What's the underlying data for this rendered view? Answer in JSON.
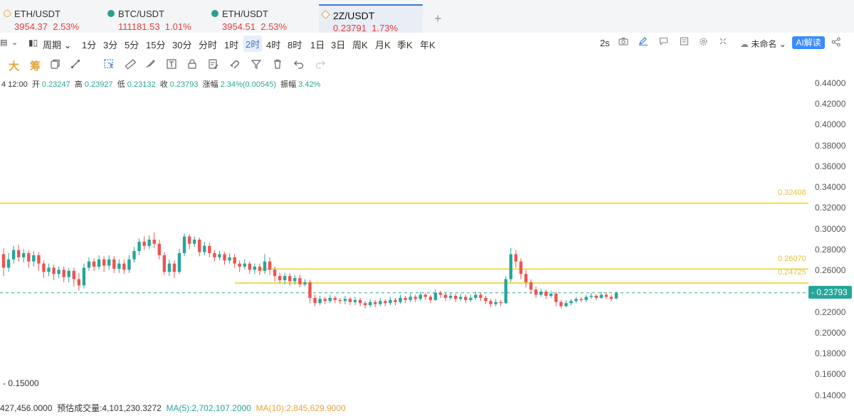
{
  "tabs": [
    {
      "symbol": "ETH/USDT",
      "price": "3954.37",
      "change": "2.53%"
    },
    {
      "symbol": "BTC/USDT",
      "price": "111181.53",
      "change": "1.01%"
    },
    {
      "symbol": "ETH/USDT",
      "price": "3954.51",
      "change": "2.53%"
    },
    {
      "symbol": "2Z/USDT",
      "price": "0.23791",
      "change": "1.73%"
    }
  ],
  "toolbar": {
    "period_label": "周期",
    "intervals": [
      "1分",
      "3分",
      "5分",
      "15分",
      "30分",
      "分时",
      "1时",
      "2时",
      "4时",
      "8时",
      "1日",
      "3日",
      "周K",
      "月K",
      "季K",
      "年K"
    ],
    "selected_interval": "2时",
    "refresh_rate": "2s",
    "layout_name": "未命名",
    "ai_button": "AI解读",
    "da_label": "大",
    "chou_label": "筹"
  },
  "ohlc": {
    "time": "4 12:00",
    "open_label": "开",
    "open": "0.23247",
    "high_label": "高",
    "high": "0.23927",
    "low_label": "低",
    "low": "0.23132",
    "close_label": "收",
    "close": "0.23793",
    "change_label": "涨幅",
    "change": "2.34%(0.00545)",
    "amp_label": "振幅",
    "amp": "3.42%"
  },
  "price_axis": [
    "0.44000",
    "0.42000",
    "0.40000",
    "0.38000",
    "0.36000",
    "0.34000",
    "0.32000",
    "0.30000",
    "0.28000",
    "0.26000",
    "0.22000",
    "0.20000",
    "0.18000",
    "0.16000",
    "0.14000"
  ],
  "horizontal_lines": [
    {
      "label": "0.32408",
      "price": 0.32408
    },
    {
      "label": "0.26070",
      "price": 0.2607
    },
    {
      "label": "0.24725",
      "price": 0.24725
    }
  ],
  "current_price": "0.23793",
  "left_value": "- 0.15000",
  "volume": {
    "prev": "427,456.0000",
    "est_label": "预估成交量:4,101,230.3272",
    "ma5": "MA(5):2,702,107.2000",
    "ma10": "MA(10):2,845,629.9000"
  },
  "colors": {
    "up": "#26a69a",
    "down": "#ef5350",
    "line": "#f2d31a",
    "accent": "#3a78d8"
  },
  "candles": [
    [
      0.275,
      0.262,
      0.281,
      0.254
    ],
    [
      0.262,
      0.27,
      0.276,
      0.258
    ],
    [
      0.27,
      0.279,
      0.283,
      0.266
    ],
    [
      0.279,
      0.272,
      0.284,
      0.268
    ],
    [
      0.272,
      0.276,
      0.28,
      0.267
    ],
    [
      0.276,
      0.268,
      0.279,
      0.262
    ],
    [
      0.268,
      0.274,
      0.278,
      0.263
    ],
    [
      0.274,
      0.266,
      0.277,
      0.259
    ],
    [
      0.266,
      0.258,
      0.269,
      0.252
    ],
    [
      0.258,
      0.262,
      0.266,
      0.254
    ],
    [
      0.262,
      0.256,
      0.265,
      0.25
    ],
    [
      0.256,
      0.26,
      0.263,
      0.252
    ],
    [
      0.26,
      0.253,
      0.263,
      0.248
    ],
    [
      0.253,
      0.259,
      0.262,
      0.248
    ],
    [
      0.259,
      0.251,
      0.262,
      0.244
    ],
    [
      0.251,
      0.245,
      0.257,
      0.24
    ],
    [
      0.245,
      0.262,
      0.266,
      0.242
    ],
    [
      0.262,
      0.268,
      0.272,
      0.259
    ],
    [
      0.268,
      0.263,
      0.271,
      0.259
    ],
    [
      0.263,
      0.27,
      0.274,
      0.26
    ],
    [
      0.27,
      0.264,
      0.273,
      0.258
    ],
    [
      0.264,
      0.27,
      0.274,
      0.26
    ],
    [
      0.27,
      0.261,
      0.273,
      0.257
    ],
    [
      0.261,
      0.266,
      0.27,
      0.257
    ],
    [
      0.266,
      0.26,
      0.27,
      0.256
    ],
    [
      0.26,
      0.27,
      0.274,
      0.257
    ],
    [
      0.27,
      0.278,
      0.282,
      0.267
    ],
    [
      0.278,
      0.287,
      0.29,
      0.274
    ],
    [
      0.287,
      0.283,
      0.292,
      0.279
    ],
    [
      0.283,
      0.289,
      0.293,
      0.28
    ],
    [
      0.289,
      0.285,
      0.296,
      0.281
    ],
    [
      0.285,
      0.274,
      0.289,
      0.27
    ],
    [
      0.274,
      0.258,
      0.277,
      0.255
    ],
    [
      0.258,
      0.266,
      0.27,
      0.254
    ],
    [
      0.266,
      0.258,
      0.269,
      0.252
    ],
    [
      0.258,
      0.276,
      0.28,
      0.256
    ],
    [
      0.276,
      0.292,
      0.295,
      0.273
    ],
    [
      0.292,
      0.285,
      0.294,
      0.28
    ],
    [
      0.285,
      0.289,
      0.292,
      0.282
    ],
    [
      0.289,
      0.277,
      0.291,
      0.273
    ],
    [
      0.277,
      0.283,
      0.287,
      0.274
    ],
    [
      0.283,
      0.276,
      0.286,
      0.272
    ],
    [
      0.276,
      0.272,
      0.279,
      0.268
    ],
    [
      0.272,
      0.275,
      0.278,
      0.269
    ],
    [
      0.275,
      0.269,
      0.277,
      0.265
    ],
    [
      0.269,
      0.272,
      0.276,
      0.266
    ],
    [
      0.272,
      0.266,
      0.275,
      0.262
    ],
    [
      0.266,
      0.263,
      0.269,
      0.258
    ],
    [
      0.263,
      0.266,
      0.27,
      0.26
    ],
    [
      0.266,
      0.26,
      0.268,
      0.256
    ],
    [
      0.26,
      0.263,
      0.266,
      0.256
    ],
    [
      0.263,
      0.259,
      0.266,
      0.255
    ],
    [
      0.259,
      0.268,
      0.275,
      0.256
    ],
    [
      0.268,
      0.26,
      0.272,
      0.255
    ],
    [
      0.26,
      0.254,
      0.263,
      0.249
    ],
    [
      0.254,
      0.25,
      0.257,
      0.247
    ],
    [
      0.25,
      0.254,
      0.257,
      0.246
    ],
    [
      0.254,
      0.249,
      0.257,
      0.245
    ],
    [
      0.249,
      0.252,
      0.255,
      0.246
    ],
    [
      0.252,
      0.246,
      0.255,
      0.243
    ],
    [
      0.246,
      0.248,
      0.251,
      0.244
    ],
    [
      0.248,
      0.233,
      0.25,
      0.228
    ],
    [
      0.233,
      0.228,
      0.236,
      0.225
    ],
    [
      0.228,
      0.232,
      0.235,
      0.226
    ],
    [
      0.232,
      0.23,
      0.234,
      0.227
    ],
    [
      0.23,
      0.233,
      0.236,
      0.228
    ],
    [
      0.233,
      0.231,
      0.235,
      0.228
    ],
    [
      0.231,
      0.23,
      0.233,
      0.227
    ],
    [
      0.23,
      0.232,
      0.235,
      0.227
    ],
    [
      0.232,
      0.229,
      0.234,
      0.226
    ],
    [
      0.229,
      0.231,
      0.234,
      0.226
    ],
    [
      0.231,
      0.228,
      0.233,
      0.225
    ],
    [
      0.228,
      0.226,
      0.23,
      0.223
    ],
    [
      0.226,
      0.229,
      0.232,
      0.224
    ],
    [
      0.229,
      0.227,
      0.231,
      0.224
    ],
    [
      0.227,
      0.23,
      0.233,
      0.225
    ],
    [
      0.23,
      0.228,
      0.232,
      0.225
    ],
    [
      0.228,
      0.231,
      0.234,
      0.226
    ],
    [
      0.231,
      0.229,
      0.233,
      0.226
    ],
    [
      0.229,
      0.233,
      0.236,
      0.227
    ],
    [
      0.233,
      0.231,
      0.235,
      0.228
    ],
    [
      0.231,
      0.234,
      0.237,
      0.229
    ],
    [
      0.234,
      0.232,
      0.236,
      0.229
    ],
    [
      0.232,
      0.236,
      0.239,
      0.23
    ],
    [
      0.236,
      0.234,
      0.238,
      0.231
    ],
    [
      0.234,
      0.231,
      0.236,
      0.228
    ],
    [
      0.231,
      0.238,
      0.241,
      0.23
    ],
    [
      0.238,
      0.236,
      0.24,
      0.233
    ],
    [
      0.236,
      0.233,
      0.238,
      0.23
    ],
    [
      0.233,
      0.235,
      0.238,
      0.231
    ],
    [
      0.235,
      0.232,
      0.237,
      0.229
    ],
    [
      0.232,
      0.234,
      0.237,
      0.23
    ],
    [
      0.234,
      0.231,
      0.236,
      0.228
    ],
    [
      0.231,
      0.233,
      0.236,
      0.229
    ],
    [
      0.233,
      0.236,
      0.239,
      0.231
    ],
    [
      0.236,
      0.233,
      0.238,
      0.23
    ],
    [
      0.233,
      0.23,
      0.235,
      0.227
    ],
    [
      0.23,
      0.227,
      0.232,
      0.224
    ],
    [
      0.227,
      0.229,
      0.232,
      0.225
    ],
    [
      0.229,
      0.228,
      0.231,
      0.225
    ],
    [
      0.228,
      0.251,
      0.254,
      0.227
    ],
    [
      0.251,
      0.275,
      0.281,
      0.248
    ],
    [
      0.275,
      0.268,
      0.279,
      0.262
    ],
    [
      0.268,
      0.256,
      0.271,
      0.251
    ],
    [
      0.256,
      0.248,
      0.26,
      0.243
    ],
    [
      0.248,
      0.241,
      0.251,
      0.237
    ],
    [
      0.241,
      0.236,
      0.244,
      0.233
    ],
    [
      0.236,
      0.239,
      0.242,
      0.234
    ],
    [
      0.239,
      0.235,
      0.241,
      0.232
    ],
    [
      0.235,
      0.237,
      0.24,
      0.233
    ],
    [
      0.237,
      0.229,
      0.239,
      0.225
    ],
    [
      0.229,
      0.225,
      0.231,
      0.223
    ],
    [
      0.225,
      0.228,
      0.231,
      0.224
    ],
    [
      0.228,
      0.23,
      0.232,
      0.226
    ],
    [
      0.23,
      0.232,
      0.234,
      0.228
    ],
    [
      0.232,
      0.231,
      0.234,
      0.229
    ],
    [
      0.231,
      0.234,
      0.236,
      0.229
    ],
    [
      0.234,
      0.235,
      0.238,
      0.232
    ],
    [
      0.235,
      0.233,
      0.237,
      0.231
    ],
    [
      0.233,
      0.236,
      0.239,
      0.232
    ],
    [
      0.236,
      0.234,
      0.238,
      0.232
    ],
    [
      0.234,
      0.232,
      0.236,
      0.23
    ],
    [
      0.2325,
      0.2379,
      0.2393,
      0.2313
    ]
  ]
}
